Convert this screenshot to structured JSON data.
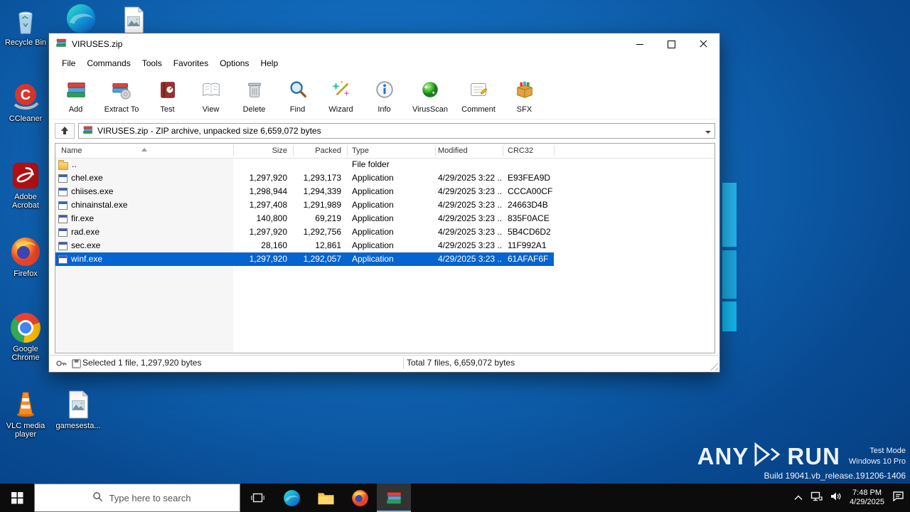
{
  "desktop": {
    "icons": [
      {
        "label": "Recycle Bin"
      },
      {
        "label": "CCleaner"
      },
      {
        "label": "Adobe Acrobat"
      },
      {
        "label": "Firefox"
      },
      {
        "label": "Google Chrome"
      },
      {
        "label": "VLC media player"
      },
      {
        "label": "gamesesta..."
      }
    ]
  },
  "winrar": {
    "title": "VIRUSES.zip",
    "menu": {
      "file": "File",
      "commands": "Commands",
      "tools": "Tools",
      "favorites": "Favorites",
      "options": "Options",
      "help": "Help"
    },
    "toolbar": {
      "add": "Add",
      "extract": "Extract To",
      "test": "Test",
      "view": "View",
      "delete": "Delete",
      "find": "Find",
      "wizard": "Wizard",
      "info": "Info",
      "virusscan": "VirusScan",
      "comment": "Comment",
      "sfx": "SFX"
    },
    "addressbar": "VIRUSES.zip - ZIP archive, unpacked size 6,659,072 bytes",
    "columns": {
      "name": "Name",
      "size": "Size",
      "packed": "Packed",
      "type": "Type",
      "modified": "Modified",
      "crc": "CRC32"
    },
    "rows": [
      {
        "name": "..",
        "size": "",
        "packed": "",
        "type": "File folder",
        "modified": "",
        "crc": ""
      },
      {
        "name": "chel.exe",
        "size": "1,297,920",
        "packed": "1,293,173",
        "type": "Application",
        "modified": "4/29/2025 3:22 ...",
        "crc": "E93FEA9D"
      },
      {
        "name": "chiises.exe",
        "size": "1,298,944",
        "packed": "1,294,339",
        "type": "Application",
        "modified": "4/29/2025 3:23 ...",
        "crc": "CCCA00CF"
      },
      {
        "name": "chinainstal.exe",
        "size": "1,297,408",
        "packed": "1,291,989",
        "type": "Application",
        "modified": "4/29/2025 3:23 ...",
        "crc": "24663D4B"
      },
      {
        "name": "fir.exe",
        "size": "140,800",
        "packed": "69,219",
        "type": "Application",
        "modified": "4/29/2025 3:23 ...",
        "crc": "835F0ACE"
      },
      {
        "name": "rad.exe",
        "size": "1,297,920",
        "packed": "1,292,756",
        "type": "Application",
        "modified": "4/29/2025 3:23 ...",
        "crc": "5B4CD6D2"
      },
      {
        "name": "sec.exe",
        "size": "28,160",
        "packed": "12,861",
        "type": "Application",
        "modified": "4/29/2025 3:23 ...",
        "crc": "11F992A1"
      },
      {
        "name": "winf.exe",
        "size": "1,297,920",
        "packed": "1,292,057",
        "type": "Application",
        "modified": "4/29/2025 3:23 ...",
        "crc": "61AFAF6F"
      }
    ],
    "status": {
      "selected": "Selected 1 file, 1,297,920 bytes",
      "total": "Total 7 files, 6,659,072 bytes"
    }
  },
  "watermark": {
    "any": "ANY",
    "run": "RUN",
    "mode": "Test Mode",
    "os": "Windows 10 Pro",
    "build": "Build 19041.vb_release.191206-1406"
  },
  "taskbar": {
    "search": "Type here to search",
    "time": "7:48 PM",
    "date": "4/29/2025"
  }
}
